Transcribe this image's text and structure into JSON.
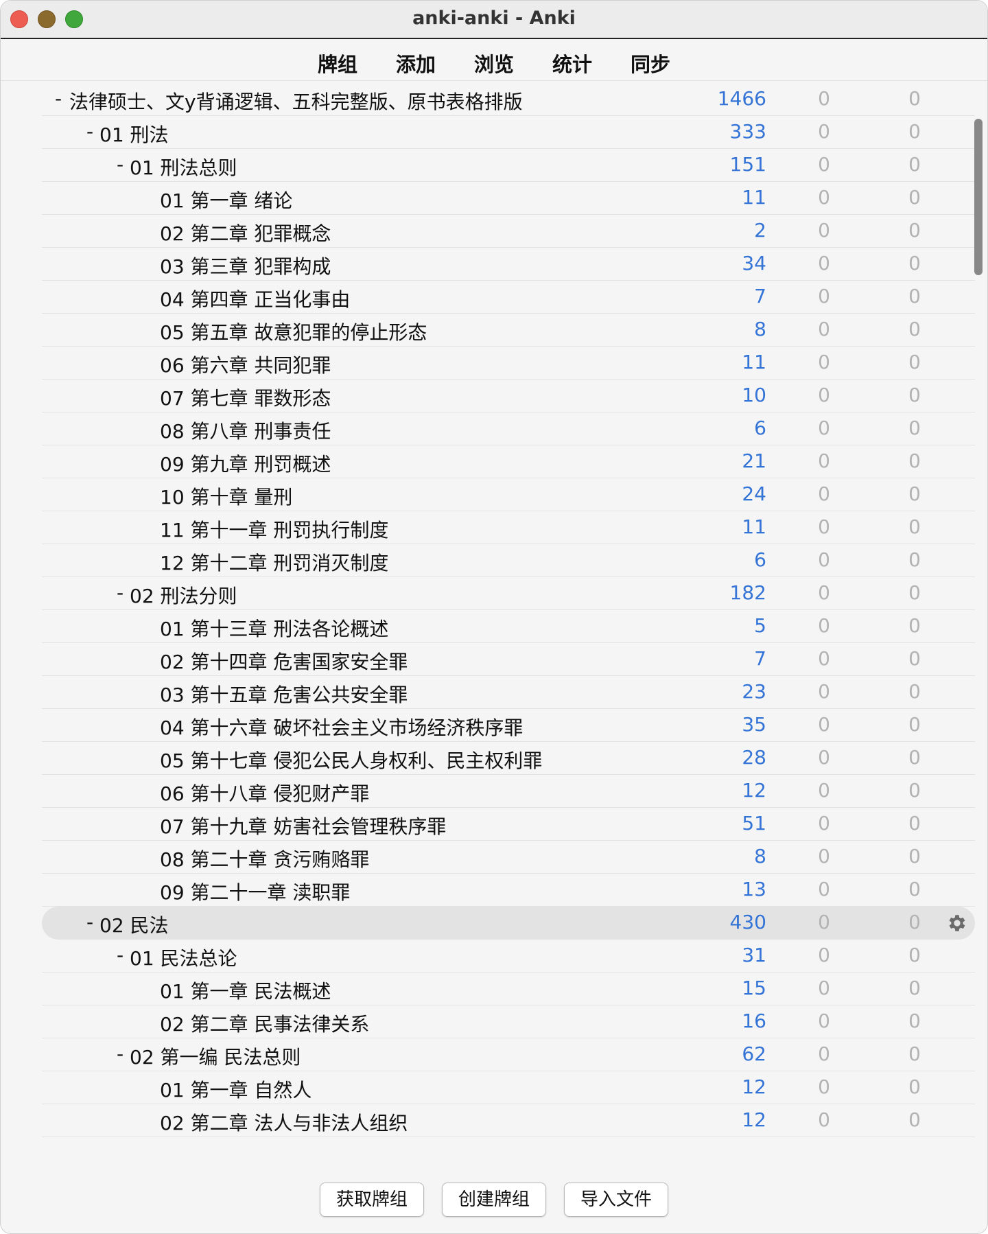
{
  "window": {
    "title": "anki-anki - Anki"
  },
  "toolbar": {
    "tabs": [
      "牌组",
      "添加",
      "浏览",
      "统计",
      "同步"
    ]
  },
  "decks": [
    {
      "level": 0,
      "collapse": "-",
      "name": "法律硕士、文y背诵逻辑、五科完整版、原书表格排版",
      "due": "1466",
      "learn": "0",
      "new": "0"
    },
    {
      "level": 1,
      "collapse": "-",
      "name": "01 刑法",
      "due": "333",
      "learn": "0",
      "new": "0"
    },
    {
      "level": 2,
      "collapse": "-",
      "name": "01 刑法总则",
      "due": "151",
      "learn": "0",
      "new": "0"
    },
    {
      "level": 3,
      "collapse": "",
      "name": "01 第一章 绪论",
      "due": "11",
      "learn": "0",
      "new": "0"
    },
    {
      "level": 3,
      "collapse": "",
      "name": "02 第二章 犯罪概念",
      "due": "2",
      "learn": "0",
      "new": "0"
    },
    {
      "level": 3,
      "collapse": "",
      "name": "03 第三章 犯罪构成",
      "due": "34",
      "learn": "0",
      "new": "0"
    },
    {
      "level": 3,
      "collapse": "",
      "name": "04 第四章 正当化事由",
      "due": "7",
      "learn": "0",
      "new": "0"
    },
    {
      "level": 3,
      "collapse": "",
      "name": "05 第五章 故意犯罪的停止形态",
      "due": "8",
      "learn": "0",
      "new": "0"
    },
    {
      "level": 3,
      "collapse": "",
      "name": "06 第六章 共同犯罪",
      "due": "11",
      "learn": "0",
      "new": "0"
    },
    {
      "level": 3,
      "collapse": "",
      "name": "07 第七章 罪数形态",
      "due": "10",
      "learn": "0",
      "new": "0"
    },
    {
      "level": 3,
      "collapse": "",
      "name": "08 第八章 刑事责任",
      "due": "6",
      "learn": "0",
      "new": "0"
    },
    {
      "level": 3,
      "collapse": "",
      "name": "09 第九章 刑罚概述",
      "due": "21",
      "learn": "0",
      "new": "0"
    },
    {
      "level": 3,
      "collapse": "",
      "name": "10 第十章 量刑",
      "due": "24",
      "learn": "0",
      "new": "0"
    },
    {
      "level": 3,
      "collapse": "",
      "name": "11 第十一章 刑罚执行制度",
      "due": "11",
      "learn": "0",
      "new": "0"
    },
    {
      "level": 3,
      "collapse": "",
      "name": "12 第十二章 刑罚消灭制度",
      "due": "6",
      "learn": "0",
      "new": "0"
    },
    {
      "level": 2,
      "collapse": "-",
      "name": "02 刑法分则",
      "due": "182",
      "learn": "0",
      "new": "0"
    },
    {
      "level": 3,
      "collapse": "",
      "name": "01 第十三章 刑法各论概述",
      "due": "5",
      "learn": "0",
      "new": "0"
    },
    {
      "level": 3,
      "collapse": "",
      "name": "02 第十四章 危害国家安全罪",
      "due": "7",
      "learn": "0",
      "new": "0"
    },
    {
      "level": 3,
      "collapse": "",
      "name": "03 第十五章 危害公共安全罪",
      "due": "23",
      "learn": "0",
      "new": "0"
    },
    {
      "level": 3,
      "collapse": "",
      "name": "04 第十六章 破坏社会主义市场经济秩序罪",
      "due": "35",
      "learn": "0",
      "new": "0"
    },
    {
      "level": 3,
      "collapse": "",
      "name": "05 第十七章 侵犯公民人身权利、民主权利罪",
      "due": "28",
      "learn": "0",
      "new": "0"
    },
    {
      "level": 3,
      "collapse": "",
      "name": "06 第十八章 侵犯财产罪",
      "due": "12",
      "learn": "0",
      "new": "0"
    },
    {
      "level": 3,
      "collapse": "",
      "name": "07 第十九章 妨害社会管理秩序罪",
      "due": "51",
      "learn": "0",
      "new": "0"
    },
    {
      "level": 3,
      "collapse": "",
      "name": "08 第二十章 贪污贿赂罪",
      "due": "8",
      "learn": "0",
      "new": "0"
    },
    {
      "level": 3,
      "collapse": "",
      "name": "09 第二十一章 渎职罪",
      "due": "13",
      "learn": "0",
      "new": "0"
    },
    {
      "level": 1,
      "collapse": "-",
      "name": "02 民法",
      "due": "430",
      "learn": "0",
      "new": "0",
      "current": true,
      "icon": "gear-icon"
    },
    {
      "level": 2,
      "collapse": "-",
      "name": "01 民法总论",
      "due": "31",
      "learn": "0",
      "new": "0"
    },
    {
      "level": 3,
      "collapse": "",
      "name": "01 第一章 民法概述",
      "due": "15",
      "learn": "0",
      "new": "0"
    },
    {
      "level": 3,
      "collapse": "",
      "name": "02 第二章 民事法律关系",
      "due": "16",
      "learn": "0",
      "new": "0"
    },
    {
      "level": 2,
      "collapse": "-",
      "name": "02 第一编 民法总则",
      "due": "62",
      "learn": "0",
      "new": "0"
    },
    {
      "level": 3,
      "collapse": "",
      "name": "01 第一章 自然人",
      "due": "12",
      "learn": "0",
      "new": "0"
    },
    {
      "level": 3,
      "collapse": "",
      "name": "02 第二章 法人与非法人组织",
      "due": "12",
      "learn": "0",
      "new": "0"
    }
  ],
  "bottom": {
    "buttons": [
      "获取牌组",
      "创建牌组",
      "导入文件"
    ]
  },
  "colors": {
    "due": "#3474d6",
    "zero": "#b3b3b3",
    "current_row": "#e3e3e3"
  }
}
